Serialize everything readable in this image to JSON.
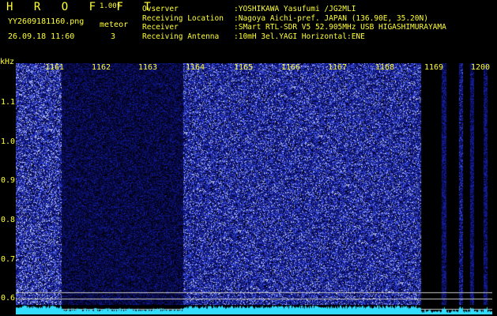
{
  "header": {
    "brand": "H R O F F T",
    "version": "1.00f",
    "filename": "YY2609181160.png",
    "mode": "meteor",
    "datetime": "26.09.18 11:60",
    "count": "3"
  },
  "station": [
    {
      "key": "Ovserver",
      "value": ":YOSHIKAWA Yasufumi /JG2MLI"
    },
    {
      "key": "Receiving Location",
      "value": ":Nagoya Aichi-pref. JAPAN (136.90E, 35.20N)"
    },
    {
      "key": "Receiver",
      "value": ":SMart RTL-SDR V5 52.905MHz USB HIGASHIMURAYAMA"
    },
    {
      "key": "Receiving Antenna",
      "value": ":10mH 3el.YAGI Horizontal:ENE"
    }
  ],
  "y_axis": {
    "unit": "kHz",
    "ticks": [
      "1.1",
      "1.0",
      "0.9",
      "0.8",
      "0.7",
      "0.6"
    ]
  },
  "x_axis": {
    "ticks": [
      "1161",
      "1162",
      "1163",
      "1164",
      "1165",
      "1166",
      "1167",
      "1168",
      "1169",
      "1200"
    ]
  },
  "colors": {
    "label": "#ffff33",
    "noise": "#2020c0",
    "spectrum": "#33ddff"
  }
}
